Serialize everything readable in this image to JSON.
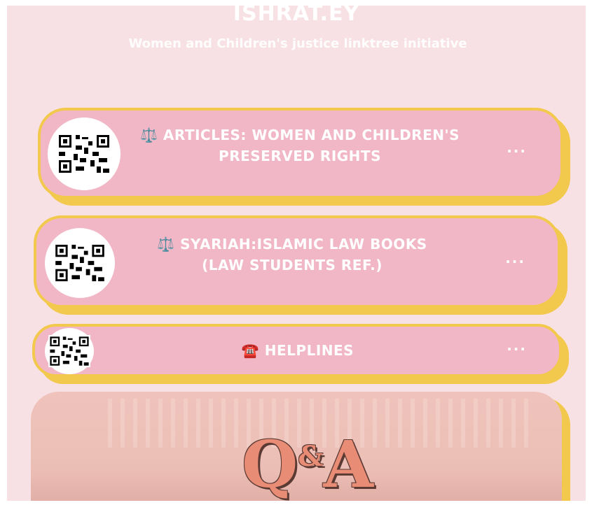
{
  "header": {
    "title": "ISHRAT.EY",
    "subtitle": "Women and Children's justice linktree initiative"
  },
  "links": [
    {
      "icon": "⚖️",
      "icon_name": "scales-icon",
      "label": "ARTICLES: WOMEN AND CHILDREN'S PRESERVED RIGHTS",
      "more": "···"
    },
    {
      "icon": "⚖️",
      "icon_name": "scales-icon",
      "label": "SYARIAH:ISLAMIC LAW BOOKS (LAW STUDENTS REF.)",
      "more": "···"
    },
    {
      "icon": "☎️",
      "icon_name": "telephone-icon",
      "label": "HELPLINES",
      "more": "···"
    }
  ],
  "qa_banner": {
    "q": "Q",
    "amp": "&",
    "a": "A"
  },
  "colors": {
    "background": "#f8e1e4",
    "card": "#f1b7c6",
    "card_border": "#f2c94c",
    "text": "#ffffff",
    "qa_text": "#e98c76"
  }
}
